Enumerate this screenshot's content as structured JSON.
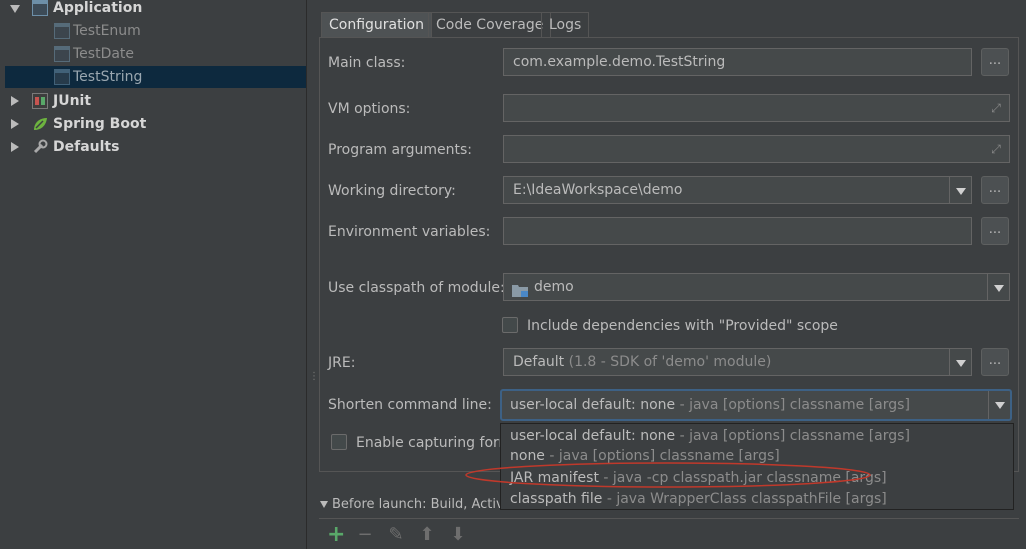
{
  "tree": {
    "application": "Application",
    "test_enum": "TestEnum",
    "test_date": "TestDate",
    "test_string": "TestString",
    "junit": "JUnit",
    "spring_boot": "Spring Boot",
    "defaults": "Defaults"
  },
  "tabs": [
    "Configuration",
    "Code Coverage",
    "Logs"
  ],
  "form": {
    "main_class_label": "Main class:",
    "main_class_value": "com.example.demo.TestString",
    "vm_options_label": "VM options:",
    "program_arguments_label": "Program arguments:",
    "working_directory_label": "Working directory:",
    "working_directory_value": "E:\\IdeaWorkspace\\demo",
    "environment_variables_label": "Environment variables:",
    "classpath_module_label": "Use classpath of module:",
    "classpath_module_value": "demo",
    "include_dependencies_label": "Include dependencies with \"Provided\" scope",
    "jre_label": "JRE:",
    "jre_value": "Default",
    "jre_hint": "(1.8 - SDK of 'demo' module)",
    "shorten_label": "Shorten command line:",
    "shorten_value": "user-local default: none",
    "shorten_hint": "- java [options] classname [args]",
    "enable_capturing_label": "Enable capturing form",
    "dots_label": "..."
  },
  "dropdown_options": [
    {
      "main": "user-local default: none",
      "hint": "- java [options] classname [args]"
    },
    {
      "main": "none",
      "hint": "- java [options] classname [args]"
    },
    {
      "main": "JAR manifest",
      "hint": "- java -cp classpath.jar classname [args]"
    },
    {
      "main": "classpath file",
      "hint": "- java WrapperClass classpathFile [args]"
    }
  ],
  "before_launch_label": "Before launch: Build, Activat",
  "colors": {
    "background": "#3c3f41",
    "selection": "#0d293e",
    "focus_border": "#3d6185",
    "annotation_ellipse": "#c0392b",
    "add_icon": "#59a869"
  },
  "toolbar_icons": [
    "add-icon",
    "remove-icon",
    "edit-icon",
    "move-up-icon",
    "move-down-icon"
  ]
}
